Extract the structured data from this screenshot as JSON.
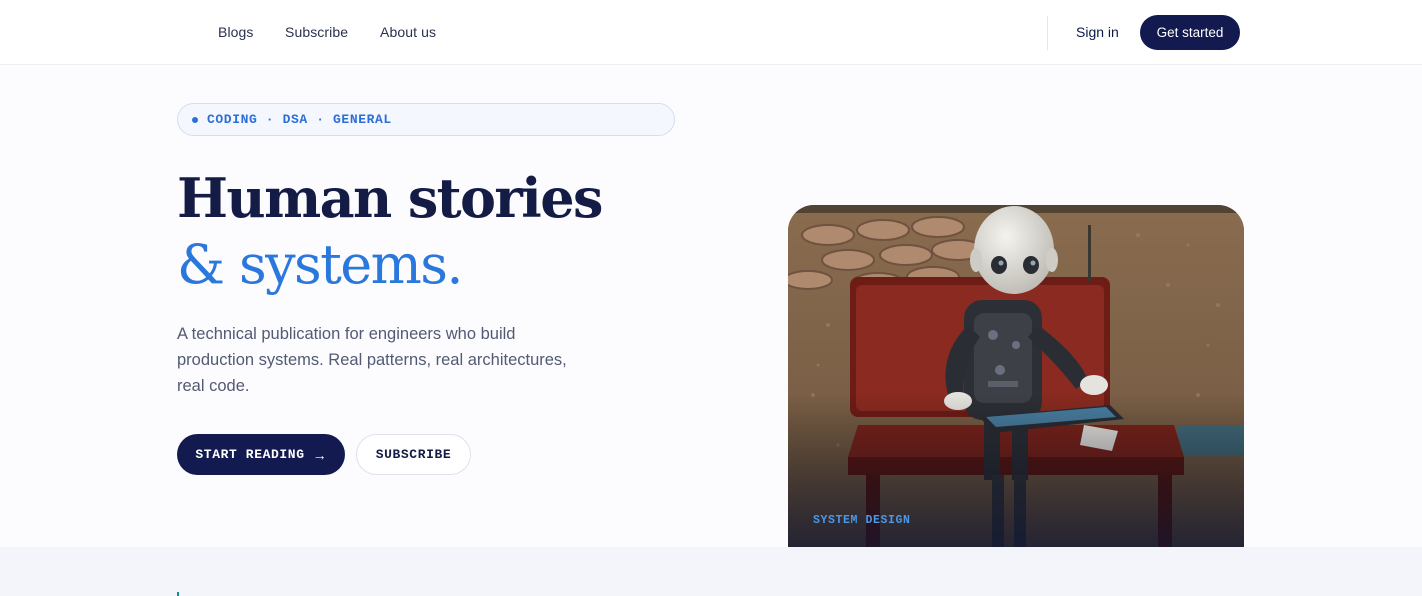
{
  "nav": {
    "links": [
      "Blogs",
      "Subscribe",
      "About us"
    ],
    "sign_in": "Sign in",
    "get_started": "Get started"
  },
  "topics": {
    "label": "CODING · DSA · GENERAL"
  },
  "hero": {
    "title_line1": "Human stories",
    "title_line2": "& systems.",
    "subtitle": "A technical publication for engineers who build production systems. Real patterns, real architectures, real code.",
    "start_reading": "START READING",
    "subscribe": "SUBSCRIBE"
  },
  "featured": {
    "category": "SYSTEM DESIGN",
    "image_icon": "robot-on-bench-photo"
  },
  "colors": {
    "navy": "#121a4f",
    "accent_blue": "#2b78dd",
    "tag_blue": "#4a98e8"
  }
}
